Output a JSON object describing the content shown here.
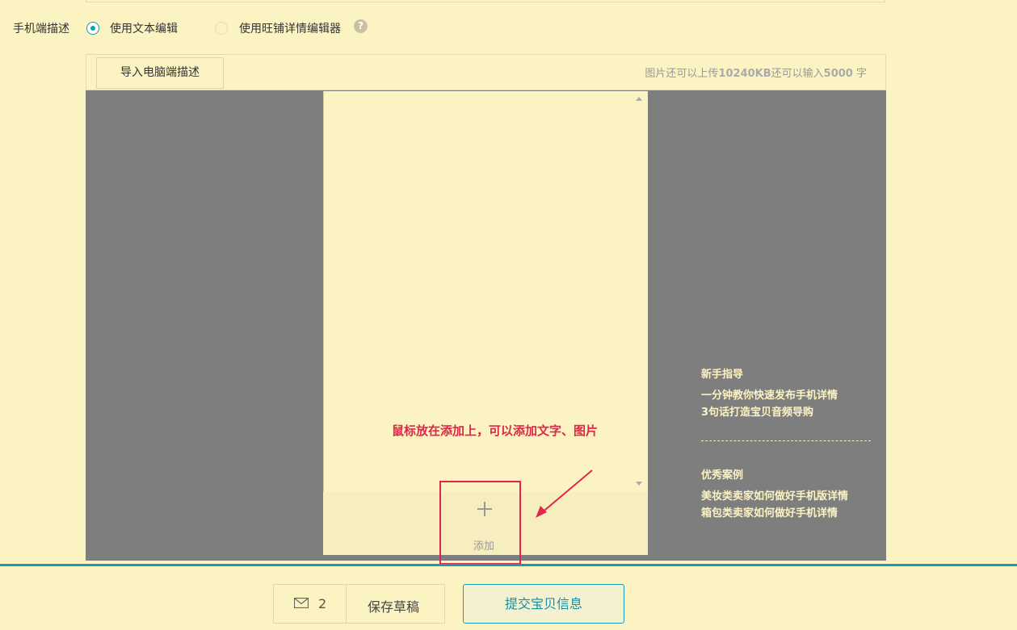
{
  "mobile_desc": {
    "label": "手机端描述",
    "option_text_editor": "使用文本编辑",
    "option_wangpu_editor": "使用旺铺详情编辑器",
    "help_glyph": "?"
  },
  "toolbar": {
    "import_label": "导入电脑端描述",
    "quota_prefix": "图片还可以上传",
    "quota_kb": "10240KB",
    "quota_middle": "还可以输入",
    "quota_chars": "5000",
    "quota_suffix": " 字"
  },
  "editor": {
    "add_label": "添加",
    "add_glyph": "+",
    "annotation": "鼠标放在添加上，可以添加文字、图片"
  },
  "guide": {
    "newbie_title": "新手指导",
    "newbie_link_1": "一分钟教你快速发布手机详情",
    "newbie_link_2": "3句话打造宝贝音频导购",
    "cases_title": "优秀案例",
    "cases_link_1": "美妆类卖家如何做好手机版详情",
    "cases_link_2": "箱包类卖家如何做好手机详情"
  },
  "footer": {
    "message_count": "2",
    "save_draft_label": "保存草稿",
    "submit_label": "提交宝贝信息"
  },
  "colors": {
    "accent": "#1a9cb0",
    "annotation_red": "#e0264a",
    "background": "#fbf3c2",
    "stage_gray": "#7e7e7f"
  },
  "icons": [
    "help-icon",
    "plus-icon",
    "mail-icon",
    "scroll-up-icon",
    "scroll-down-icon",
    "arrow-annotation-icon"
  ]
}
